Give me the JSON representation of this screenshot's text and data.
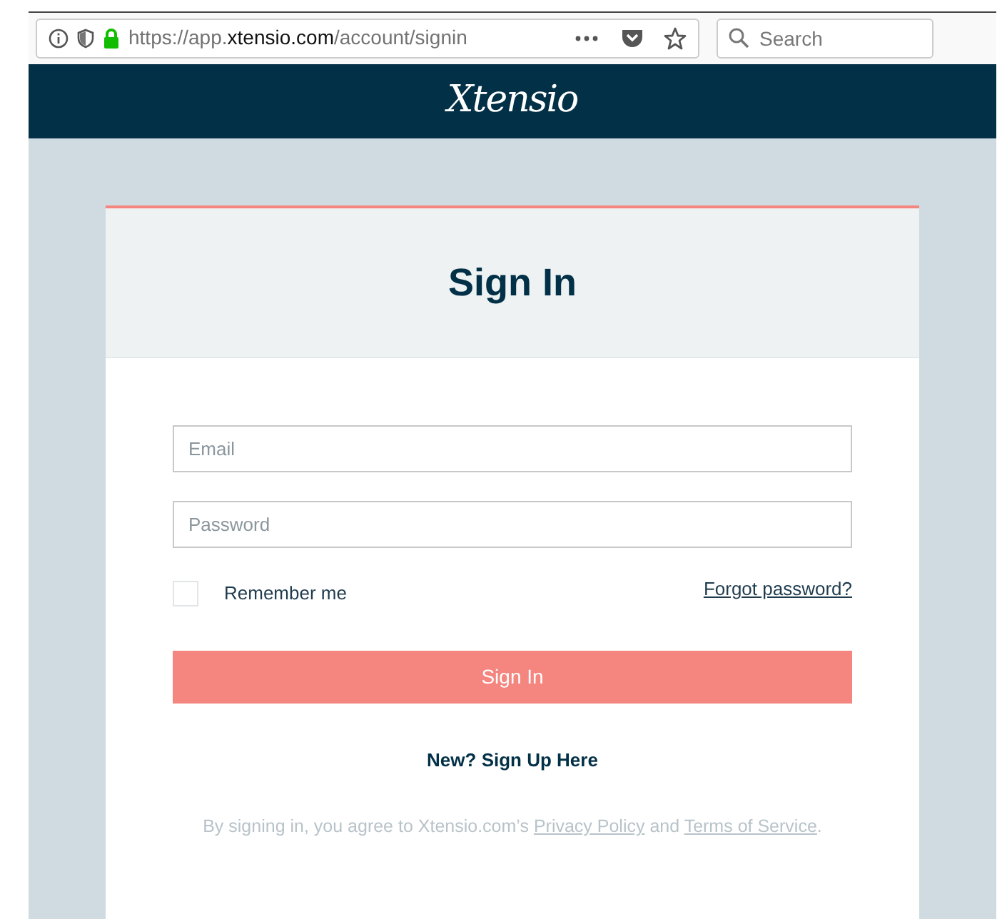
{
  "browser": {
    "url_prefix": "https://app.",
    "url_domain": "xtensio.com",
    "url_path": "/account/signin",
    "search_placeholder": "Search"
  },
  "header": {
    "logo": "Xtensio"
  },
  "form": {
    "title": "Sign In",
    "fields": [
      {
        "placeholder": "Email"
      },
      {
        "placeholder": "Password"
      }
    ],
    "remember": {
      "label": "Remember me",
      "checked": false
    },
    "forgot_link": "Forgot password?",
    "submit": "Sign In",
    "signup_link": "New? Sign Up Here",
    "notice": {
      "before": "By signing in, you agree to Xtensio.com’s ",
      "link_1": "Privacy Policy",
      "middle": " and ",
      "link_2": "Terms of Service",
      "after": "."
    }
  }
}
